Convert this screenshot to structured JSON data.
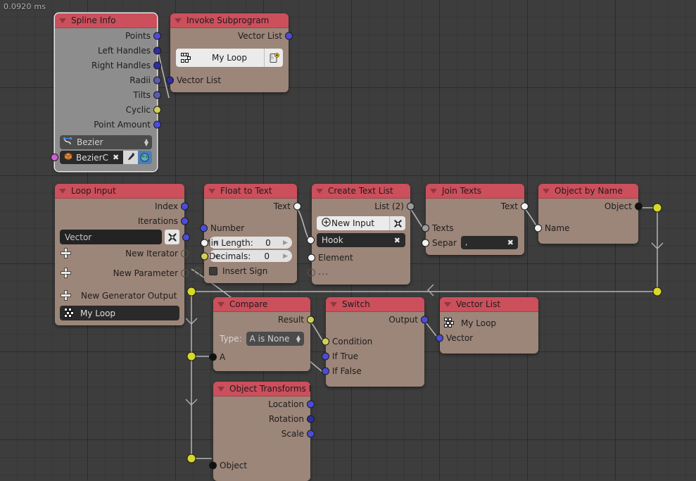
{
  "editor": {
    "stats": "0.0920 ms",
    "background": "#3d3d3d",
    "grid_color": "#353535"
  },
  "theme": {
    "header_red": "#cc4f5c",
    "node_body": "#9c8579",
    "node_body_gray": "#8d8d8d",
    "socket_vector": "#4c4cd6",
    "socket_boolean": "#cfcf5a",
    "socket_text": "#f2f2f2",
    "socket_object": "#121212",
    "reroute_yellow": "#d8d828",
    "wire": "#b5b5b5"
  },
  "nodes": [
    {
      "id": "spline-info",
      "title": "Spline Info",
      "outputs": [
        "Points",
        "Left Handles",
        "Right Handles",
        "Radii",
        "Tilts",
        "Cyclic",
        "Point Amount"
      ],
      "spline_type": "Bezier",
      "object_name": "BezierC",
      "inputs": []
    },
    {
      "id": "invoke-subprogram",
      "title": "Invoke Subprogram",
      "outputs": [
        "Vector List"
      ],
      "subprogram": "My Loop",
      "inputs": [
        "Vector List"
      ]
    },
    {
      "id": "loop-input",
      "title": "Loop Input",
      "outputs": [
        "Index",
        "Iterations"
      ],
      "iterator_value": "Vector",
      "new_iterator": "New Iterator",
      "new_parameter": "New Parameter",
      "new_generator_output": "New Generator Output",
      "subprogram": "My Loop"
    },
    {
      "id": "float-to-text",
      "title": "Float to Text",
      "outputs": [
        "Text"
      ],
      "inputs": [
        "Number"
      ],
      "min_length_label": "Min Length:",
      "min_length_value": "0",
      "decimals_label": "Decimals:",
      "decimals_value": "0",
      "insert_sign_label": "Insert Sign",
      "insert_sign_checked": false
    },
    {
      "id": "create-text-list",
      "title": "Create Text List",
      "outputs": [
        "List (2)"
      ],
      "new_input_label": "New Input",
      "hook_label": "Hook",
      "inputs": [
        "Element",
        "..."
      ]
    },
    {
      "id": "join-texts",
      "title": "Join Texts",
      "outputs": [
        "Text"
      ],
      "inputs": [
        "Texts",
        "Separ"
      ],
      "separator_value": ","
    },
    {
      "id": "object-by-name",
      "title": "Object by Name",
      "outputs": [
        "Object"
      ],
      "inputs": [
        "Name"
      ]
    },
    {
      "id": "compare",
      "title": "Compare",
      "outputs": [
        "Result"
      ],
      "type_label": "Type:",
      "type_value": "A is None",
      "inputs": [
        "A"
      ]
    },
    {
      "id": "switch",
      "title": "Switch",
      "outputs": [
        "Output"
      ],
      "inputs": [
        "Condition",
        "If True",
        "If False"
      ]
    },
    {
      "id": "vector-list",
      "title": "Vector List",
      "subprogram": "My Loop",
      "inputs": [
        "Vector"
      ],
      "outputs": []
    },
    {
      "id": "object-transforms",
      "title": "Object Transforms I…",
      "outputs": [
        "Location",
        "Rotation",
        "Scale"
      ],
      "inputs": [
        "Object"
      ]
    }
  ],
  "icons": {
    "collapse": "triangle-down-icon",
    "subprogram": "subprogram-dots-icon",
    "bezier": "bezier-curve-icon",
    "object": "object-cube-icon",
    "eyedropper": "eyedropper-icon",
    "world": "world-globe-icon",
    "link": "link-to-subprogram-icon",
    "unlink": "unlink-x-icon",
    "remove": "remove-x-icon",
    "add": "add-plus-icon"
  }
}
